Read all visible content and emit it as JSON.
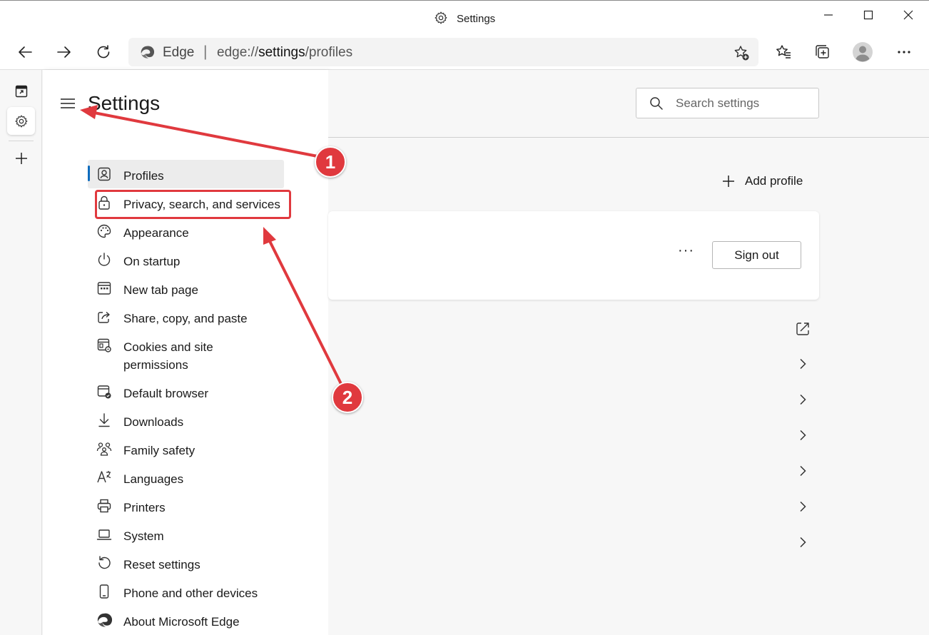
{
  "window": {
    "title": "Settings"
  },
  "address": {
    "site": "Edge",
    "separator": "|",
    "url_prefix": "edge://",
    "url_bold": "settings",
    "url_suffix": "/profiles"
  },
  "settings_title": "Settings",
  "nav": {
    "items": [
      {
        "label": "Profiles",
        "icon": "profile-icon"
      },
      {
        "label": "Privacy, search, and services",
        "icon": "lock-icon"
      },
      {
        "label": "Appearance",
        "icon": "palette-icon"
      },
      {
        "label": "On startup",
        "icon": "power-icon"
      },
      {
        "label": "New tab page",
        "icon": "new-tab-icon"
      },
      {
        "label": "Share, copy, and paste",
        "icon": "share-icon"
      },
      {
        "label": "Cookies and site permissions",
        "icon": "cookies-icon"
      },
      {
        "label": "Default browser",
        "icon": "browser-icon"
      },
      {
        "label": "Downloads",
        "icon": "download-icon"
      },
      {
        "label": "Family safety",
        "icon": "family-icon"
      },
      {
        "label": "Languages",
        "icon": "language-icon"
      },
      {
        "label": "Printers",
        "icon": "printer-icon"
      },
      {
        "label": "System",
        "icon": "laptop-icon"
      },
      {
        "label": "Reset settings",
        "icon": "reset-icon"
      },
      {
        "label": "Phone and other devices",
        "icon": "phone-icon"
      },
      {
        "label": "About Microsoft Edge",
        "icon": "edge-logo-icon"
      }
    ]
  },
  "search": {
    "placeholder": "Search settings"
  },
  "main": {
    "add_profile": "Add profile",
    "more": "···",
    "sign_out": "Sign out"
  },
  "annotations": {
    "badge1": "1",
    "badge2": "2"
  },
  "colors": {
    "annotation_red": "#e0393e",
    "accent_blue": "#0f6cbd"
  }
}
